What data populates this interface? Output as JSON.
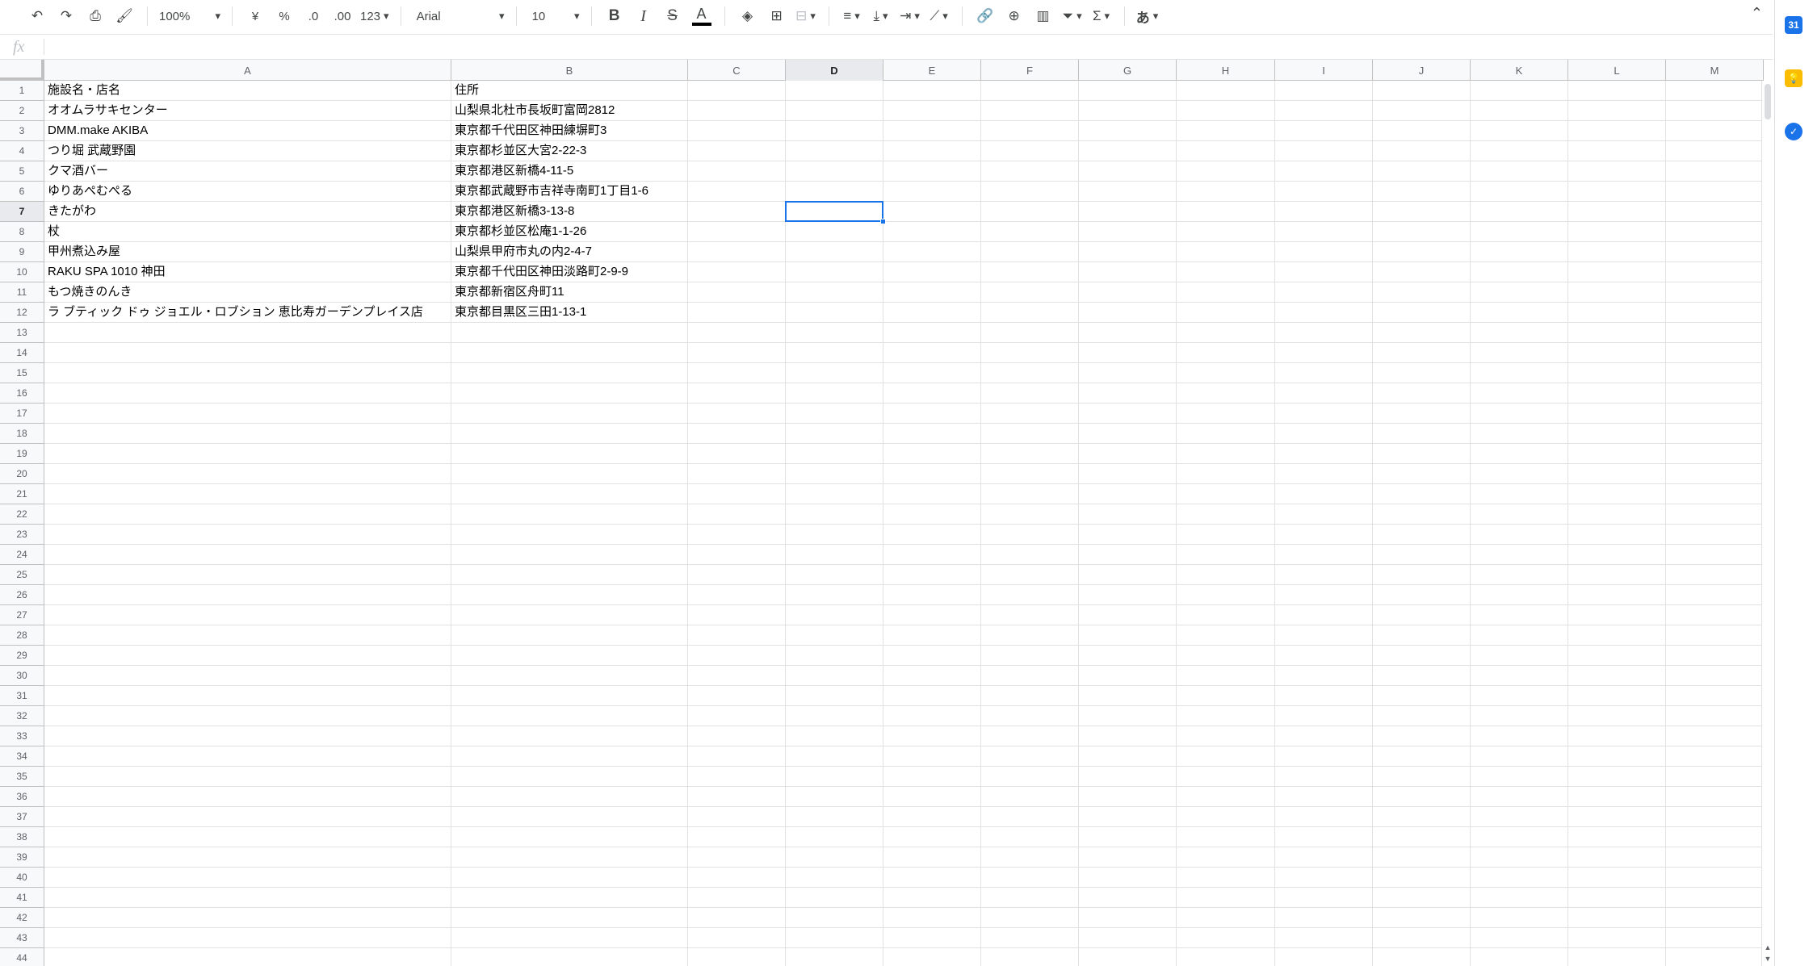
{
  "toolbar": {
    "zoom": "100%",
    "currency": "¥",
    "percent": "%",
    "decimal_decrease": ".0",
    "decimal_increase": ".00",
    "number_format": "123",
    "font_name": "Arial",
    "font_size": "10",
    "bold": "B",
    "italic": "I",
    "strike": "S",
    "text_color": "A",
    "sum": "Σ",
    "input_tools": "あ"
  },
  "formula_bar": {
    "fx": "fx",
    "value": ""
  },
  "columns": [
    {
      "label": "A",
      "width": 0
    },
    {
      "label": "B",
      "width": 0
    }
  ],
  "column_labels": [
    "A",
    "B",
    "C",
    "D",
    "E",
    "F",
    "G",
    "H",
    "I",
    "J",
    "K",
    "L",
    "M"
  ],
  "active_column": "D",
  "active_row": 7,
  "rows": [
    [
      "施設名・店名",
      "住所"
    ],
    [
      "オオムラサキセンター",
      "山梨県北杜市長坂町富岡2812"
    ],
    [
      "DMM.make AKIBA",
      "東京都千代田区神田練塀町3"
    ],
    [
      "つり堀 武蔵野園",
      "東京都杉並区大宮2-22-3"
    ],
    [
      "クマ酒バー",
      "東京都港区新橋4-11-5"
    ],
    [
      "ゆりあぺむぺる",
      "東京都武蔵野市吉祥寺南町1丁目1-6"
    ],
    [
      "きたがわ",
      "東京都港区新橋3-13-8"
    ],
    [
      "杖",
      "東京都杉並区松庵1-1-26"
    ],
    [
      "甲州煮込み屋",
      "山梨県甲府市丸の内2-4-7"
    ],
    [
      "RAKU SPA 1010 神田",
      "東京都千代田区神田淡路町2-9-9"
    ],
    [
      "もつ焼きのんき",
      "東京都新宿区舟町11"
    ],
    [
      "ラ ブティック ドゥ ジョエル・ロブション 恵比寿ガーデンプレイス店",
      "東京都目黒区三田1-13-1"
    ]
  ],
  "total_rows": 44,
  "side_icons": [
    {
      "name": "calendar-icon",
      "color": "#1a73e8",
      "glyph": "31"
    },
    {
      "name": "keep-icon",
      "color": "#fbbc04",
      "glyph": "💡"
    },
    {
      "name": "tasks-icon",
      "color": "#1a73e8",
      "glyph": "✓"
    }
  ]
}
